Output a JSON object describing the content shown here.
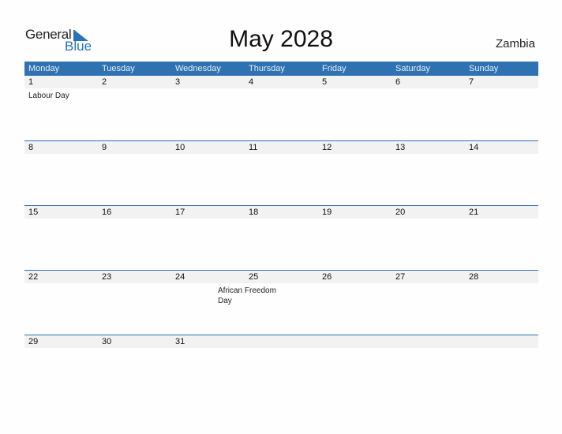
{
  "logo": {
    "general": "General",
    "blue": "Blue"
  },
  "title": "May 2028",
  "country": "Zambia",
  "weekdays": [
    "Monday",
    "Tuesday",
    "Wednesday",
    "Thursday",
    "Friday",
    "Saturday",
    "Sunday"
  ],
  "weeks": [
    {
      "days": [
        "1",
        "2",
        "3",
        "4",
        "5",
        "6",
        "7"
      ],
      "events": [
        "Labour Day",
        "",
        "",
        "",
        "",
        "",
        ""
      ]
    },
    {
      "days": [
        "8",
        "9",
        "10",
        "11",
        "12",
        "13",
        "14"
      ],
      "events": [
        "",
        "",
        "",
        "",
        "",
        "",
        ""
      ]
    },
    {
      "days": [
        "15",
        "16",
        "17",
        "18",
        "19",
        "20",
        "21"
      ],
      "events": [
        "",
        "",
        "",
        "",
        "",
        "",
        ""
      ]
    },
    {
      "days": [
        "22",
        "23",
        "24",
        "25",
        "26",
        "27",
        "28"
      ],
      "events": [
        "",
        "",
        "",
        "African Freedom Day",
        "",
        "",
        ""
      ]
    },
    {
      "days": [
        "29",
        "30",
        "31",
        "",
        "",
        "",
        ""
      ],
      "events": [
        "",
        "",
        "",
        "",
        "",
        "",
        ""
      ]
    }
  ]
}
